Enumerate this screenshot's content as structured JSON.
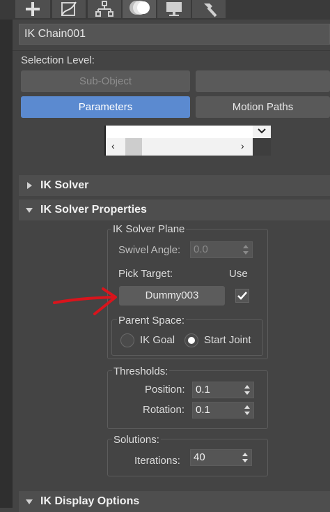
{
  "toolbar": {
    "tabs": [
      {
        "icon": "create-plus-icon"
      },
      {
        "icon": "modify-curve-icon"
      },
      {
        "icon": "hierarchy-icon"
      },
      {
        "icon": "motion-icon"
      },
      {
        "icon": "display-monitor-icon"
      },
      {
        "icon": "utilities-hammer-icon"
      }
    ]
  },
  "object_name": "IK Chain001",
  "selection_level": {
    "label": "Selection Level:",
    "sub_object_button": "Sub-Object",
    "parameters_tab": "Parameters",
    "motion_paths_tab": "Motion Paths"
  },
  "rollouts": {
    "ik_solver": "IK Solver",
    "ik_solver_properties": "IK Solver Properties",
    "ik_display_options": "IK Display Options"
  },
  "ik_solver_plane": {
    "title": "IK Solver Plane",
    "swivel_angle_label": "Swivel Angle:",
    "swivel_angle_value": "0.0",
    "pick_target_label": "Pick Target:",
    "use_label": "Use",
    "target_button": "Dummy003",
    "use_checked": true,
    "parent_space": {
      "title": "Parent Space:",
      "ik_goal_label": "IK Goal",
      "start_joint_label": "Start Joint",
      "selected": "Start Joint"
    }
  },
  "thresholds": {
    "title": "Thresholds:",
    "position_label": "Position:",
    "position_value": "0.1",
    "rotation_label": "Rotation:",
    "rotation_value": "0.1"
  },
  "solutions": {
    "title": "Solutions:",
    "iterations_label": "Iterations:",
    "iterations_value": "40"
  },
  "colors": {
    "active_tab": "#5b8ad0",
    "annotation_arrow": "#d9141c"
  }
}
